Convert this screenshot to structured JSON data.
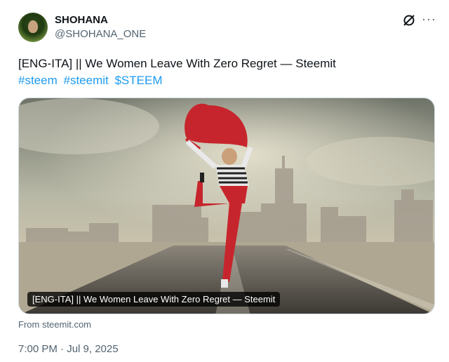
{
  "author": {
    "display_name": "SHOHANA",
    "handle": "@SHOHANA_ONE"
  },
  "tweet": {
    "text": "[ENG-ITA] || We Women Leave With Zero Regret — Steemit",
    "hashtags": [
      "#steem",
      "#steemit",
      "$STEEM"
    ]
  },
  "link_card": {
    "title": "[ENG-ITA] || We Women Leave With Zero Regret — Steemit",
    "source": "From steemit.com"
  },
  "timestamp": "7:00 PM · Jul 9, 2025",
  "icons": {
    "grok": "grok-icon",
    "more": "more-options-icon"
  },
  "colors": {
    "link": "#1d9bf0",
    "muted": "#536471"
  }
}
